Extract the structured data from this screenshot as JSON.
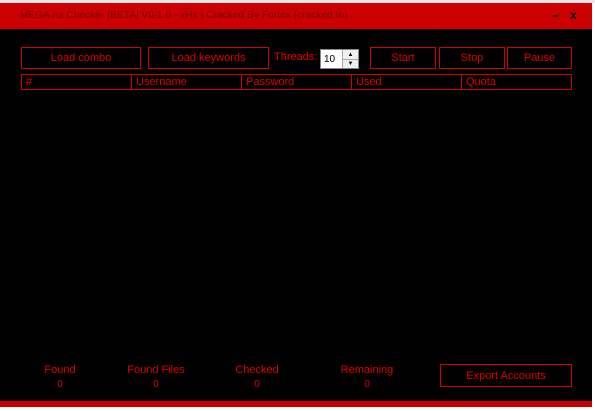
{
  "window": {
    "title": "MEGA.nz Checker [BETA] V0.1.0 - xHx | Cracked By Fortex (cracked.to)",
    "minimize": "–",
    "close": "x"
  },
  "toolbar": {
    "load_combo": "Load combo",
    "load_keywords": "Load keywords",
    "threads_label": "Threads:",
    "threads_value": "10",
    "start": "Start",
    "stop": "Stop",
    "pause": "Pause"
  },
  "table": {
    "columns": [
      "#",
      "Username",
      "Password",
      "Used",
      "Quota"
    ],
    "rows": []
  },
  "stats": [
    {
      "label": "Found",
      "value": "0"
    },
    {
      "label": "Found Files",
      "value": "0"
    },
    {
      "label": "Checked",
      "value": "0"
    },
    {
      "label": "Remaining",
      "value": "0"
    }
  ],
  "export_button": "Export Accounts",
  "colors": {
    "accent": "#cc0000",
    "text": "#e00000",
    "background": "#000000"
  }
}
